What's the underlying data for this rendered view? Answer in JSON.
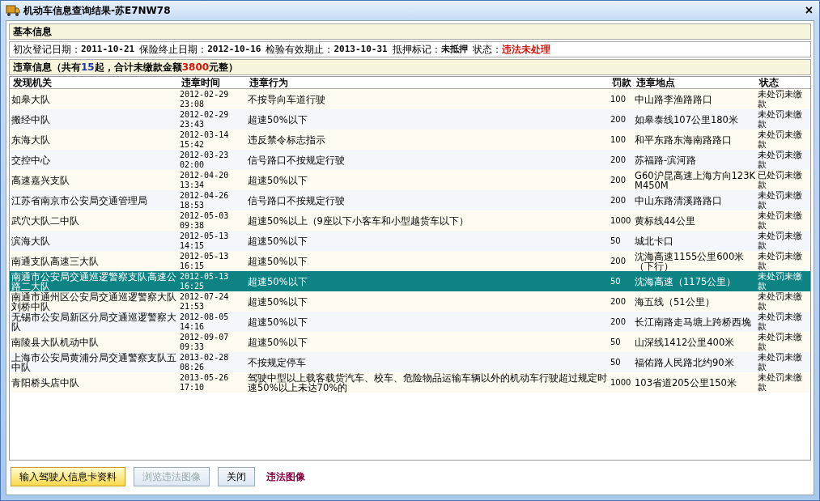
{
  "window": {
    "title": "机动车信息查询结果-苏E7NW78",
    "close": "×"
  },
  "basic_info": {
    "heading": "基本信息",
    "fields": [
      {
        "label": "初次登记日期：",
        "value": "2011-10-21",
        "alert": false
      },
      {
        "label": "保险终止日期：",
        "value": "2012-10-16",
        "alert": false
      },
      {
        "label": "检验有效期止：",
        "value": "2013-10-31",
        "alert": false
      },
      {
        "label": "抵押标记：",
        "value": "未抵押",
        "alert": false
      },
      {
        "label": "状态：",
        "value": "违法未处理",
        "alert": true
      }
    ]
  },
  "violations": {
    "heading": {
      "prefix": "违章信息（共有",
      "count": "15",
      "middle": "起，合计未缴款金额",
      "amount": "3800",
      "suffix": "元整）"
    },
    "columns": [
      "发现机关",
      "违章时间",
      "违章行为",
      "罚款",
      "违章地点",
      "状态"
    ],
    "rows": [
      {
        "selected": false,
        "cells": [
          "如皋大队",
          "2012-02-29 23:08",
          "不按导向车道行驶",
          "100",
          "中山路李渔路路口",
          "未处罚未缴款"
        ]
      },
      {
        "selected": false,
        "cells": [
          "搬经中队",
          "2012-02-29 23:43",
          "超速50%以下",
          "200",
          "如皋泰线107公里180米",
          "未处罚未缴款"
        ]
      },
      {
        "selected": false,
        "cells": [
          "东海大队",
          "2012-03-14 15:42",
          "违反禁令标志指示",
          "100",
          "和平东路东海南路路口",
          "未处罚未缴款"
        ]
      },
      {
        "selected": false,
        "cells": [
          "交控中心",
          "2012-03-23 02:00",
          "信号路口不按规定行驶",
          "200",
          "苏福路-滨河路",
          "未处罚未缴款"
        ]
      },
      {
        "selected": false,
        "cells": [
          "高速嘉兴支队",
          "2012-04-20 13:34",
          "超速50%以下",
          "200",
          "G60沪昆高速上海方向123KM450M",
          "已处罚未缴款"
        ]
      },
      {
        "selected": false,
        "cells": [
          "江苏省南京市公安局交通管理局",
          "2012-04-26 18:53",
          "信号路口不按规定行驶",
          "200",
          "中山东路清溪路路口",
          "未处罚未缴款"
        ]
      },
      {
        "selected": false,
        "cells": [
          "武穴大队二中队",
          "2012-05-03 09:38",
          "超速50%以上（9座以下小客车和小型越货车以下）",
          "1000",
          "黄标线44公里",
          "未处罚未缴款"
        ]
      },
      {
        "selected": false,
        "cells": [
          "滨海大队",
          "2012-05-13 14:15",
          "超速50%以下",
          "50",
          "城北卡口",
          "未处罚未缴款"
        ]
      },
      {
        "selected": false,
        "cells": [
          "南通支队高速三大队",
          "2012-05-13 16:15",
          "超速50%以下",
          "200",
          "沈海高速1155公里600米（下行）",
          "未处罚未缴款"
        ]
      },
      {
        "selected": true,
        "cells": [
          "南通市公安局交通巡逻警察支队高速公路二大队",
          "2012-05-13 16:25",
          "超速50%以下",
          "50",
          "沈海高速（1175公里）",
          "未处罚未缴款"
        ]
      },
      {
        "selected": false,
        "cells": [
          "南通市通州区公安局交通巡逻警察大队刘桥中队",
          "2012-07-24 21:53",
          "超速50%以下",
          "200",
          "海五线（51公里）",
          "未处罚未缴款"
        ]
      },
      {
        "selected": false,
        "cells": [
          "无锡市公安局新区分局交通巡逻警察大队",
          "2012-08-05 14:16",
          "超速50%以下",
          "200",
          "长江南路走马塘上跨桥西堍",
          "未处罚未缴款"
        ]
      },
      {
        "selected": false,
        "cells": [
          "南陵县大队机动中队",
          "2012-09-07 09:33",
          "超速50%以下",
          "50",
          "山深线1412公里400米",
          "未处罚未缴款"
        ]
      },
      {
        "selected": false,
        "cells": [
          "上海市公安局黄浦分局交通警察支队五中队",
          "2013-02-28 08:26",
          "不按规定停车",
          "50",
          "福佑路人民路北约90米",
          "未处罚未缴款"
        ]
      },
      {
        "selected": false,
        "cells": [
          "青阳桥头店中队",
          "2013-05-26 17:10",
          "驾驶中型以上载客载货汽车、校车、危险物品运输车辆以外的机动车行驶超过规定时速50%以上未达70%的",
          "1000",
          "103省道205公里150米",
          "未处罚未缴款"
        ]
      }
    ]
  },
  "buttons": [
    {
      "label": "输入驾驶人信息卡资料",
      "highlighted": true,
      "disabled": false
    },
    {
      "label": "浏览违法图像",
      "highlighted": false,
      "disabled": true
    },
    {
      "label": "关闭",
      "highlighted": false,
      "disabled": false
    }
  ],
  "link": "违法图像"
}
